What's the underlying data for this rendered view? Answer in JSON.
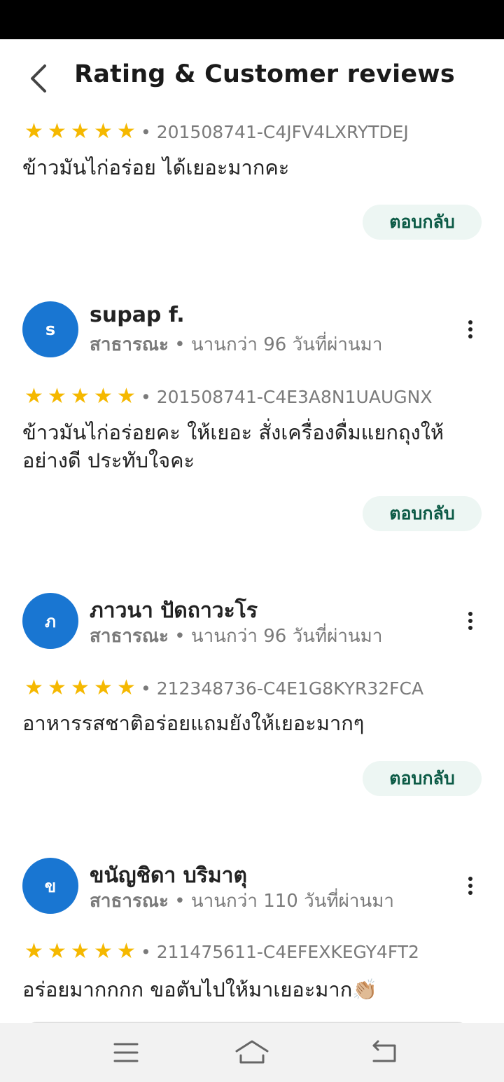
{
  "header": {
    "title": "Rating & Customer reviews"
  },
  "reply_label": "ตอบกลับ",
  "star_char": "★",
  "colors": {
    "avatar": "#1976d2",
    "star": "#f5b800",
    "reply_bg": "#edf6f3",
    "reply_text": "#0b5a45"
  },
  "icons": {
    "back": "chevron-left-icon",
    "more": "more-vertical-icon",
    "menu": "menu-icon",
    "home": "home-icon",
    "back_nav": "back-arrow-icon"
  },
  "reviews": [
    {
      "rating": 5,
      "order_id": "• 201508741-C4JFV4LXRYTDEJ",
      "text": "ข้าวมันไก่อร่อย ได้เยอะมากคะ"
    },
    {
      "initial": "s",
      "name": "supap f.",
      "visibility": "สาธารณะ",
      "time": "• นานกว่า 96 วันที่ผ่านมา",
      "rating": 5,
      "order_id": "• 201508741-C4E3A8N1UAUGNX",
      "text": "ข้าวมันไก่อร่อยคะ ให้เยอะ สั่งเครื่องดื่มแยกถุงให้อย่างดี ประทับใจคะ"
    },
    {
      "initial": "ภ",
      "name": "ภาวนา ปัดถาวะโร",
      "visibility": "สาธารณะ",
      "time": "• นานกว่า 96 วันที่ผ่านมา",
      "rating": 5,
      "order_id": "• 212348736-C4E1G8KYR32FCA",
      "text": "อาหารรสชาติอร่อยแถมยังให้เยอะมากๆ"
    },
    {
      "initial": "ข",
      "name": "ขนัญชิดา บริมาตุ",
      "visibility": "สาธารณะ",
      "time": "• นานกว่า 110 วันที่ผ่านมา",
      "rating": 5,
      "order_id": "• 211475611-C4EFEXKEGY4FT2",
      "text": "อร่อยมากกกก ขอตับไปให้มาเยอะมาก👏🏼"
    }
  ]
}
